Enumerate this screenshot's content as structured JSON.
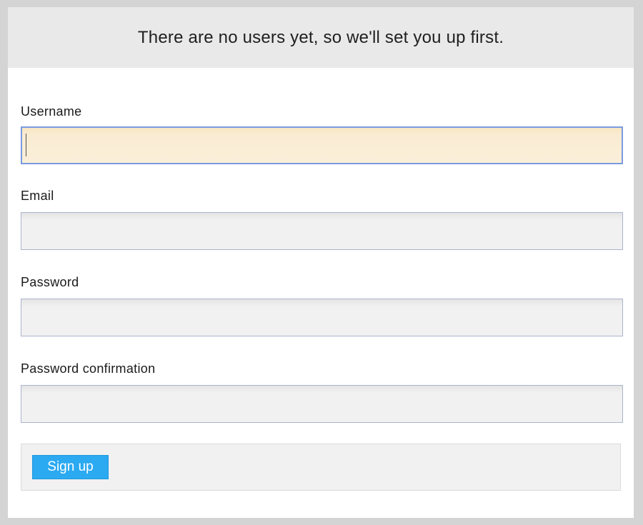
{
  "header": {
    "title": "There are no users yet, so we'll set you up first."
  },
  "form": {
    "username_label": "Username",
    "username_value": "",
    "email_label": "Email",
    "email_value": "",
    "password_label": "Password",
    "password_value": "",
    "password_confirmation_label": "Password confirmation",
    "password_confirmation_value": "",
    "submit_label": "Sign up"
  },
  "colors": {
    "page_background": "#d4d4d4",
    "header_background": "#e9e9e9",
    "focused_input_background": "#faefd9",
    "focused_input_border": "#7b9be0",
    "button_background": "#2ba9f1"
  }
}
